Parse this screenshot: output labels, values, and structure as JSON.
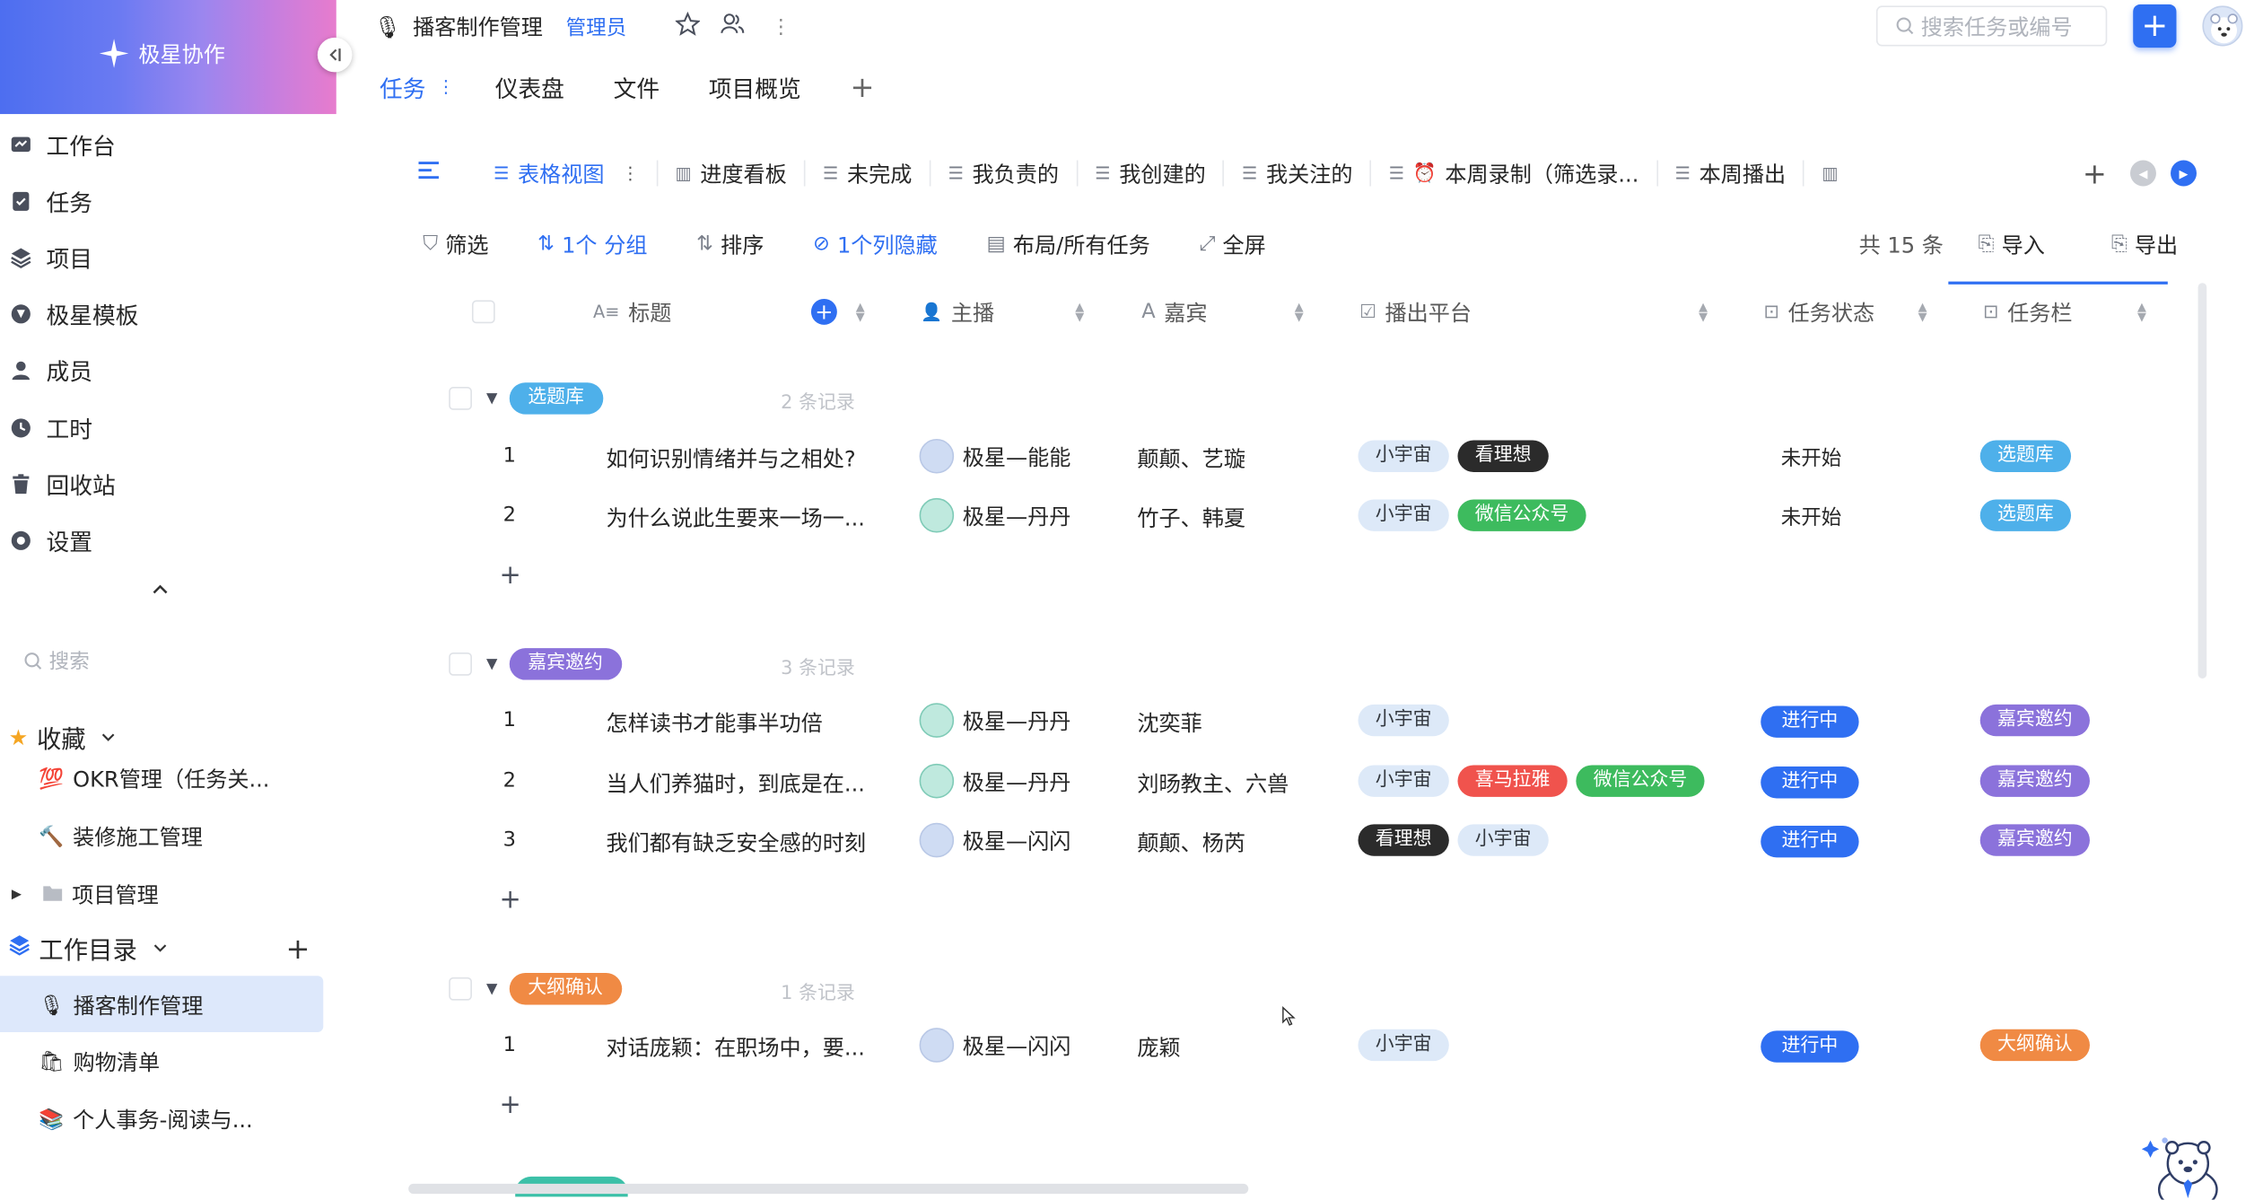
{
  "brand": {
    "name": "极星协作"
  },
  "sidebar": {
    "nav": [
      {
        "label": "工作台",
        "icon": "dashboard-icon"
      },
      {
        "label": "任务",
        "icon": "task-icon"
      },
      {
        "label": "项目",
        "icon": "layers-icon"
      },
      {
        "label": "极星模板",
        "icon": "template-icon"
      },
      {
        "label": "成员",
        "icon": "user-icon"
      },
      {
        "label": "工时",
        "icon": "clock-icon"
      },
      {
        "label": "回收站",
        "icon": "trash-icon"
      },
      {
        "label": "设置",
        "icon": "settings-icon"
      }
    ],
    "search_placeholder": "搜索",
    "favorites": {
      "title": "收藏",
      "items": [
        {
          "label": "OKR管理（任务关...",
          "emoji": "💯"
        },
        {
          "label": "装修施工管理",
          "emoji": "🔨"
        },
        {
          "label": "项目管理",
          "emoji": "📁"
        }
      ]
    },
    "workdir": {
      "title": "工作目录",
      "items": [
        {
          "label": "播客制作管理",
          "emoji": "🎙"
        },
        {
          "label": "购物清单",
          "emoji": "🛍"
        },
        {
          "label": "个人事务-阅读与...",
          "emoji": "📚"
        }
      ]
    }
  },
  "header": {
    "project_title": "播客制作管理",
    "role_badge": "管理员",
    "search_placeholder": "搜索任务或编号",
    "tabs": [
      {
        "label": "任务"
      },
      {
        "label": "仪表盘"
      },
      {
        "label": "文件"
      },
      {
        "label": "项目概览"
      }
    ]
  },
  "views": [
    {
      "label": "表格视图",
      "active": true
    },
    {
      "label": "进度看板"
    },
    {
      "label": "未完成"
    },
    {
      "label": "我负责的"
    },
    {
      "label": "我创建的"
    },
    {
      "label": "我关注的"
    },
    {
      "label": "本周录制（筛选录..."
    },
    {
      "label": "本周播出"
    }
  ],
  "toolbar": {
    "filter": "筛选",
    "group": "1个 分组",
    "sort": "排序",
    "hidden": "1个列隐藏",
    "layout": "布局/所有任务",
    "fullscreen": "全屏",
    "total": "共 15 条",
    "import": "导入",
    "export": "导出"
  },
  "columns": {
    "title": "标题",
    "host": "主播",
    "guest": "嘉宾",
    "platform": "播出平台",
    "status": "任务状态",
    "stage": "任务栏"
  },
  "colors": {
    "accent": "#2f6ff2",
    "group_blue": "#4eb0ea",
    "group_purple": "#8b72db",
    "group_orange": "#f08a44"
  },
  "groups": [
    {
      "name": "选题库",
      "count": "2 条记录",
      "color": "#4eb0ea",
      "rows": [
        {
          "no": "1",
          "title": "如何识别情绪并与之相处?",
          "host": "极星—能能",
          "guest": "颠颠、艺璇",
          "tags": [
            "小宇宙",
            "看理想"
          ],
          "status": "未开始",
          "stage": "选题库"
        },
        {
          "no": "2",
          "title": "为什么说此生要来一场一...",
          "host": "极星—丹丹",
          "guest": "竹子、韩夏",
          "tags": [
            "小宇宙",
            "微信公众号"
          ],
          "status": "未开始",
          "stage": "选题库"
        }
      ]
    },
    {
      "name": "嘉宾邀约",
      "count": "3 条记录",
      "color": "#8b72db",
      "rows": [
        {
          "no": "1",
          "title": "怎样读书才能事半功倍",
          "host": "极星—丹丹",
          "guest": "沈奕菲",
          "tags": [
            "小宇宙"
          ],
          "status": "进行中",
          "stage": "嘉宾邀约"
        },
        {
          "no": "2",
          "title": "当人们养猫时，到底是在...",
          "host": "极星—丹丹",
          "guest": "刘旸教主、六兽",
          "tags": [
            "小宇宙",
            "喜马拉雅",
            "微信公众号"
          ],
          "status": "进行中",
          "stage": "嘉宾邀约"
        },
        {
          "no": "3",
          "title": "我们都有缺乏安全感的时刻",
          "host": "极星—闪闪",
          "guest": "颠颠、杨芮",
          "tags": [
            "看理想",
            "小宇宙"
          ],
          "status": "进行中",
          "stage": "嘉宾邀约"
        }
      ]
    },
    {
      "name": "大纲确认",
      "count": "1 条记录",
      "color": "#f08a44",
      "rows": [
        {
          "no": "1",
          "title": "对话庞颖：在职场中，要...",
          "host": "极星—闪闪",
          "guest": "庞颖",
          "tags": [
            "小宇宙"
          ],
          "status": "进行中",
          "stage": "大纲确认"
        }
      ]
    }
  ]
}
